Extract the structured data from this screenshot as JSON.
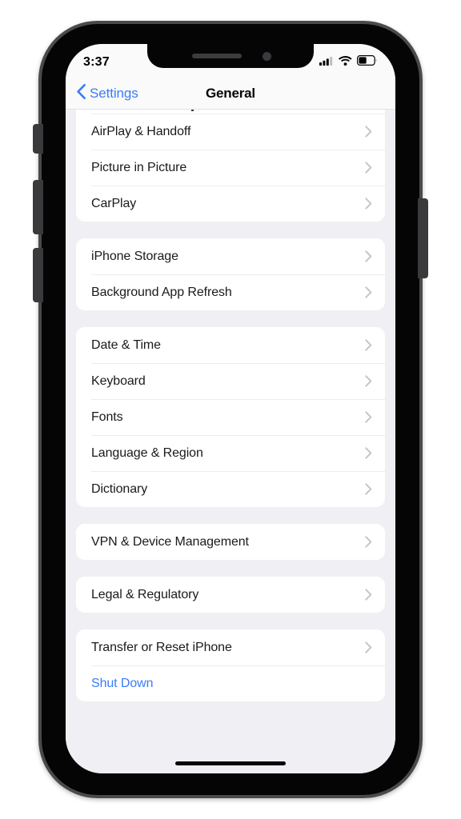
{
  "status_bar": {
    "time": "3:37",
    "icons": [
      "cellular-signal-icon",
      "wifi-icon",
      "battery-icon"
    ],
    "battery_level_pct": 45
  },
  "nav_bar": {
    "back_label": "Settings",
    "back_icon": "chevron-left-icon",
    "title": "General"
  },
  "colors": {
    "accent_blue": "#3b7cf6",
    "background": "#f0eff4",
    "card": "#ffffff",
    "separator": "#eceaef",
    "chevron": "#c4c4c8",
    "label": "#1a1a1c"
  },
  "groups": [
    {
      "clipped_top": true,
      "rows": [
        {
          "label": "AirPlay & Handoff",
          "accessory": "chevron-right-icon",
          "style": "default"
        },
        {
          "label": "Picture in Picture",
          "accessory": "chevron-right-icon",
          "style": "default"
        },
        {
          "label": "CarPlay",
          "accessory": "chevron-right-icon",
          "style": "default"
        }
      ]
    },
    {
      "clipped_top": false,
      "rows": [
        {
          "label": "iPhone Storage",
          "accessory": "chevron-right-icon",
          "style": "default"
        },
        {
          "label": "Background App Refresh",
          "accessory": "chevron-right-icon",
          "style": "default"
        }
      ]
    },
    {
      "clipped_top": false,
      "rows": [
        {
          "label": "Date & Time",
          "accessory": "chevron-right-icon",
          "style": "default"
        },
        {
          "label": "Keyboard",
          "accessory": "chevron-right-icon",
          "style": "default"
        },
        {
          "label": "Fonts",
          "accessory": "chevron-right-icon",
          "style": "default"
        },
        {
          "label": "Language & Region",
          "accessory": "chevron-right-icon",
          "style": "default"
        },
        {
          "label": "Dictionary",
          "accessory": "chevron-right-icon",
          "style": "default"
        }
      ]
    },
    {
      "clipped_top": false,
      "rows": [
        {
          "label": "VPN & Device Management",
          "accessory": "chevron-right-icon",
          "style": "default"
        }
      ]
    },
    {
      "clipped_top": false,
      "rows": [
        {
          "label": "Legal & Regulatory",
          "accessory": "chevron-right-icon",
          "style": "default"
        }
      ]
    },
    {
      "clipped_top": false,
      "rows": [
        {
          "label": "Transfer or Reset iPhone",
          "accessory": "chevron-right-icon",
          "style": "default"
        },
        {
          "label": "Shut Down",
          "accessory": "none",
          "style": "link"
        }
      ]
    }
  ],
  "device": {
    "buttons": [
      "silent-switch",
      "volume-up-button",
      "volume-down-button",
      "power-button"
    ],
    "notch_elements": [
      "notch-speaker",
      "notch-camera"
    ],
    "home_indicator": true
  }
}
